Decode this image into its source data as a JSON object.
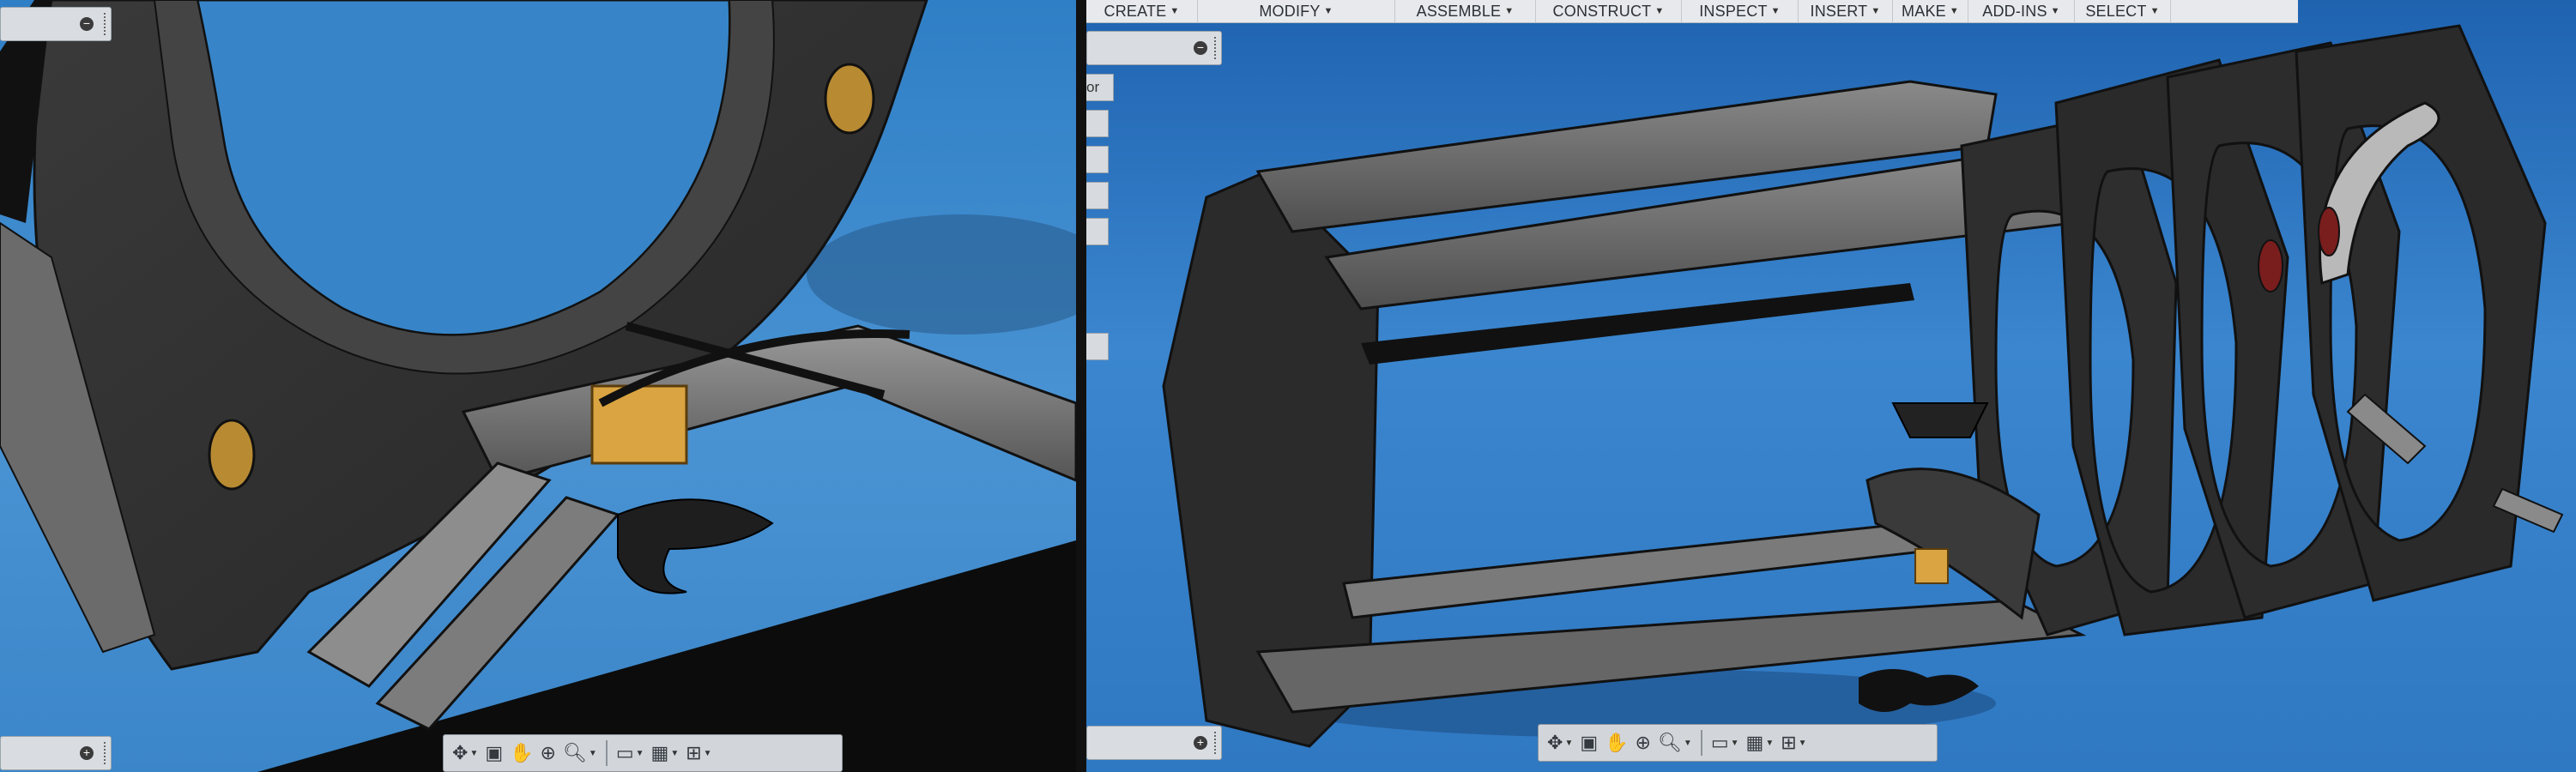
{
  "menubar": {
    "items": [
      {
        "label": "CREATE"
      },
      {
        "label": "MODIFY"
      },
      {
        "label": "ASSEMBLE"
      },
      {
        "label": "CONSTRUCT"
      },
      {
        "label": "INSPECT"
      },
      {
        "label": "INSERT"
      },
      {
        "label": "MAKE"
      },
      {
        "label": "ADD-INS"
      },
      {
        "label": "SELECT"
      }
    ],
    "dropdown_glyph": "▼"
  },
  "browser_panel": {
    "truncated_tab_label": "or"
  },
  "panels": {
    "collapse_glyph": "−",
    "expand_glyph": "+"
  },
  "nav_toolbar": {
    "icons": [
      "orbit-icon",
      "look-at-icon",
      "pan-icon",
      "zoom-window-icon",
      "zoom-icon",
      "display-settings-icon",
      "grid-settings-icon",
      "viewports-icon"
    ]
  },
  "colors": {
    "viewport_blue": "#3b86c9",
    "part_dark": "#2d2d2d",
    "part_light": "#8a8a8a",
    "accent_gold": "#d9a441",
    "accent_red": "#7a1d1d",
    "ui_panel": "#d2d6db"
  }
}
